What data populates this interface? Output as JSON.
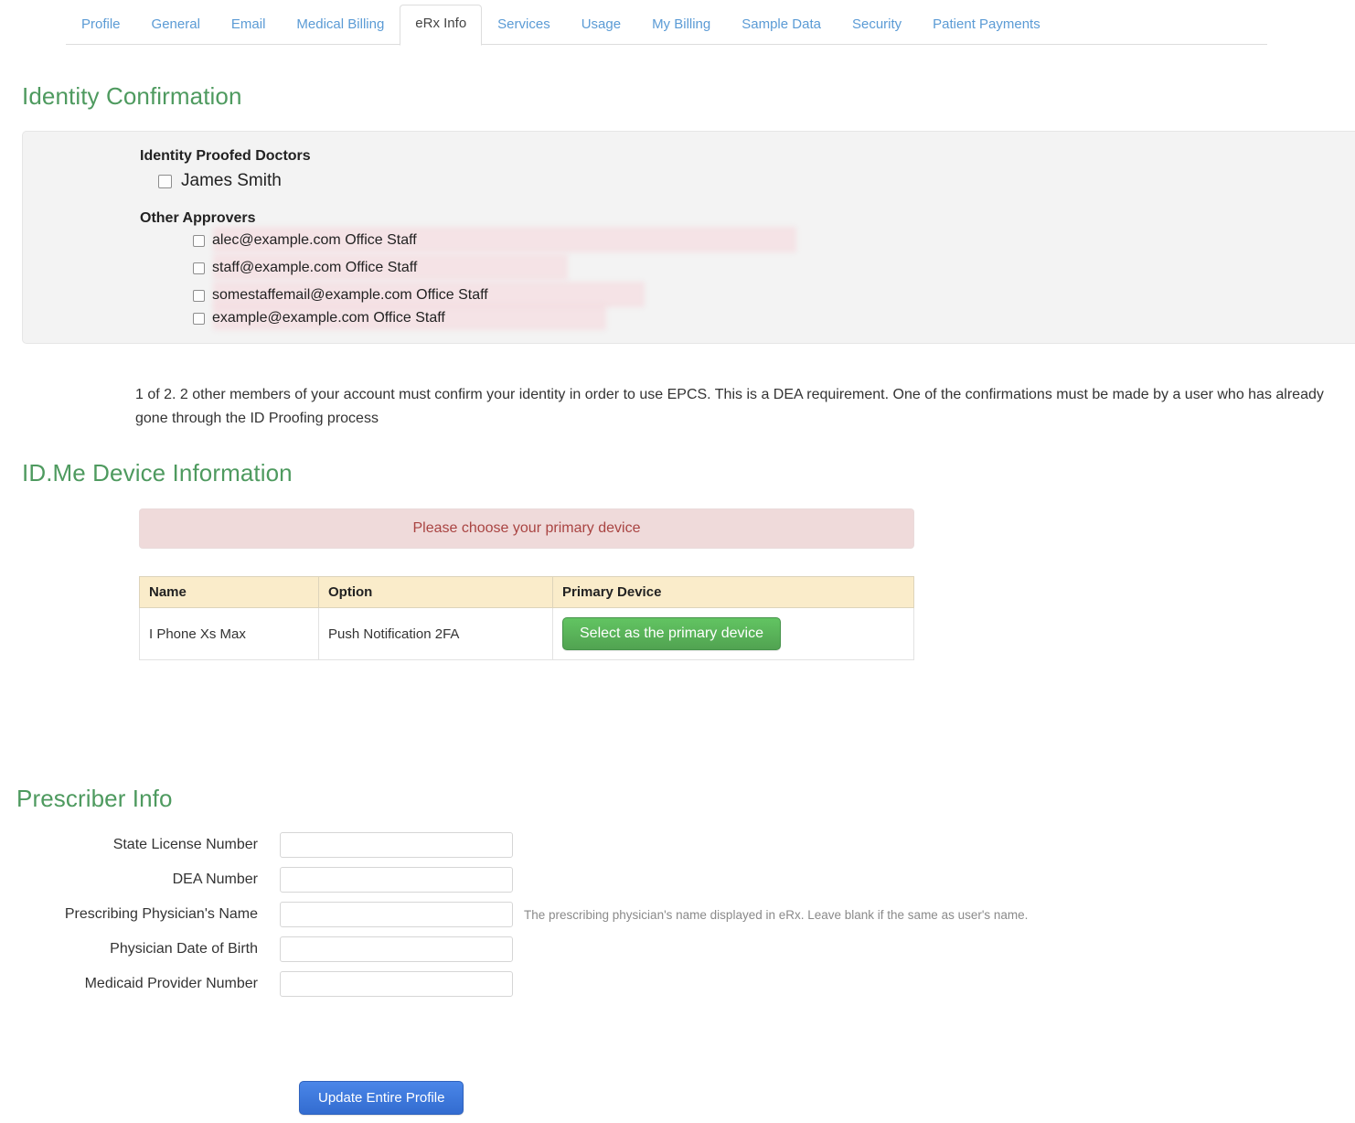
{
  "tabs": [
    {
      "label": "Profile",
      "active": false
    },
    {
      "label": "General",
      "active": false
    },
    {
      "label": "Email",
      "active": false
    },
    {
      "label": "Medical Billing",
      "active": false
    },
    {
      "label": "eRx Info",
      "active": true
    },
    {
      "label": "Services",
      "active": false
    },
    {
      "label": "Usage",
      "active": false
    },
    {
      "label": "My Billing",
      "active": false
    },
    {
      "label": "Sample Data",
      "active": false
    },
    {
      "label": "Security",
      "active": false
    },
    {
      "label": "Patient Payments",
      "active": false
    }
  ],
  "identity": {
    "title": "Identity Confirmation",
    "proofed_doctors_label": "Identity Proofed Doctors",
    "doctors": [
      {
        "name": "James Smith",
        "checked": false
      }
    ],
    "other_approvers_label": "Other Approvers",
    "approvers": [
      {
        "name": "alec@example.com Office Staff",
        "checked": false
      },
      {
        "name": "staff@example.com Office Staff",
        "checked": false
      },
      {
        "name": "somestaffemail@example.com Office Staff",
        "checked": false
      },
      {
        "name": "example@example.com Office Staff",
        "checked": false
      }
    ],
    "explanation": "1 of 2. 2 other members of your account must confirm your identity in order to use EPCS. This is a DEA requirement. One of the confirmations must be made by a user who has already gone through the ID Proofing process"
  },
  "idme": {
    "title": "ID.Me Device Information",
    "alert": "Please choose your primary device",
    "alert_color": "#a94442",
    "table": {
      "headers": [
        "Name",
        "Option",
        "Primary Device"
      ],
      "rows": [
        {
          "name": "I Phone Xs Max",
          "option": "Push Notification 2FA",
          "action_label": "Select as the primary device"
        }
      ]
    }
  },
  "prescriber": {
    "title": "Prescriber Info",
    "fields": [
      {
        "label": "State License Number",
        "value": "",
        "help": ""
      },
      {
        "label": "DEA Number",
        "value": "",
        "help": ""
      },
      {
        "label": "Prescribing Physician's Name",
        "value": "",
        "help": "The prescribing physician's name displayed in eRx. Leave blank if the same as user's name."
      },
      {
        "label": "Physician Date of Birth",
        "value": "",
        "help": ""
      },
      {
        "label": "Medicaid Provider Number",
        "value": "",
        "help": ""
      }
    ]
  },
  "footer": {
    "update_label": "Update Entire Profile"
  },
  "colors": {
    "heading_green": "#4e9a5f",
    "tab_link_blue": "#5b9bd5",
    "alert_pink_bg": "#efdada",
    "table_header_tan": "#faecca",
    "green_button": "#51a351",
    "blue_button": "#3a76d8"
  }
}
